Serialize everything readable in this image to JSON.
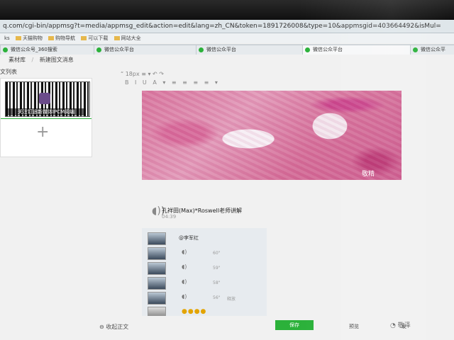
{
  "browser": {
    "url": "q.com/cgi-bin/appmsg?t=media/appmsg_edit&action=edit&lang=zh_CN&token=1891726008&type=10&appmsgid=403664492&isMul=",
    "bookmarks": [
      "ks",
      "天猫购物",
      "购物导航",
      "可以下载",
      "网站大全"
    ],
    "tabs": [
      {
        "label": "微信公众号_360搜索",
        "active": false
      },
      {
        "label": "微信公众平台",
        "active": false
      },
      {
        "label": "微信公众平台",
        "active": false
      },
      {
        "label": "微信公众平台",
        "active": true
      },
      {
        "label": "微信公众平",
        "active": false
      }
    ]
  },
  "breadcrumb": {
    "back": "素材库",
    "current": "新建图文消息"
  },
  "left_panel": {
    "label": "文列表",
    "qr_caption": "关注钉途新媒体IPCM阅编"
  },
  "toolbar": {
    "row1": "“   18px   ≡   ▾   ↶   ↷",
    "row2": "B I U A ▾ ≡ ≡ ≡ ≡ ▾"
  },
  "article": {
    "watermark": "敬精",
    "audio_title": "孔祥田(Max)*Roswell老师讲解",
    "audio_time": "04:39"
  },
  "comments": [
    {
      "type": "text",
      "name": "@李军红",
      "dur": "",
      "extra": ""
    },
    {
      "type": "voice",
      "name": "",
      "dur": "60\"",
      "extra": ""
    },
    {
      "type": "voice",
      "name": "",
      "dur": "59\"",
      "extra": ""
    },
    {
      "type": "voice",
      "name": "",
      "dur": "58\"",
      "extra": ""
    },
    {
      "type": "voice",
      "name": "",
      "dur": "56\"",
      "extra": "释放"
    },
    {
      "type": "emoji",
      "name": "",
      "dur": "",
      "extra": ""
    }
  ],
  "footer": {
    "collapse": "收起正文",
    "save": "保存",
    "preview": "预览",
    "send": "发"
  },
  "corner_logo": "敬泽"
}
